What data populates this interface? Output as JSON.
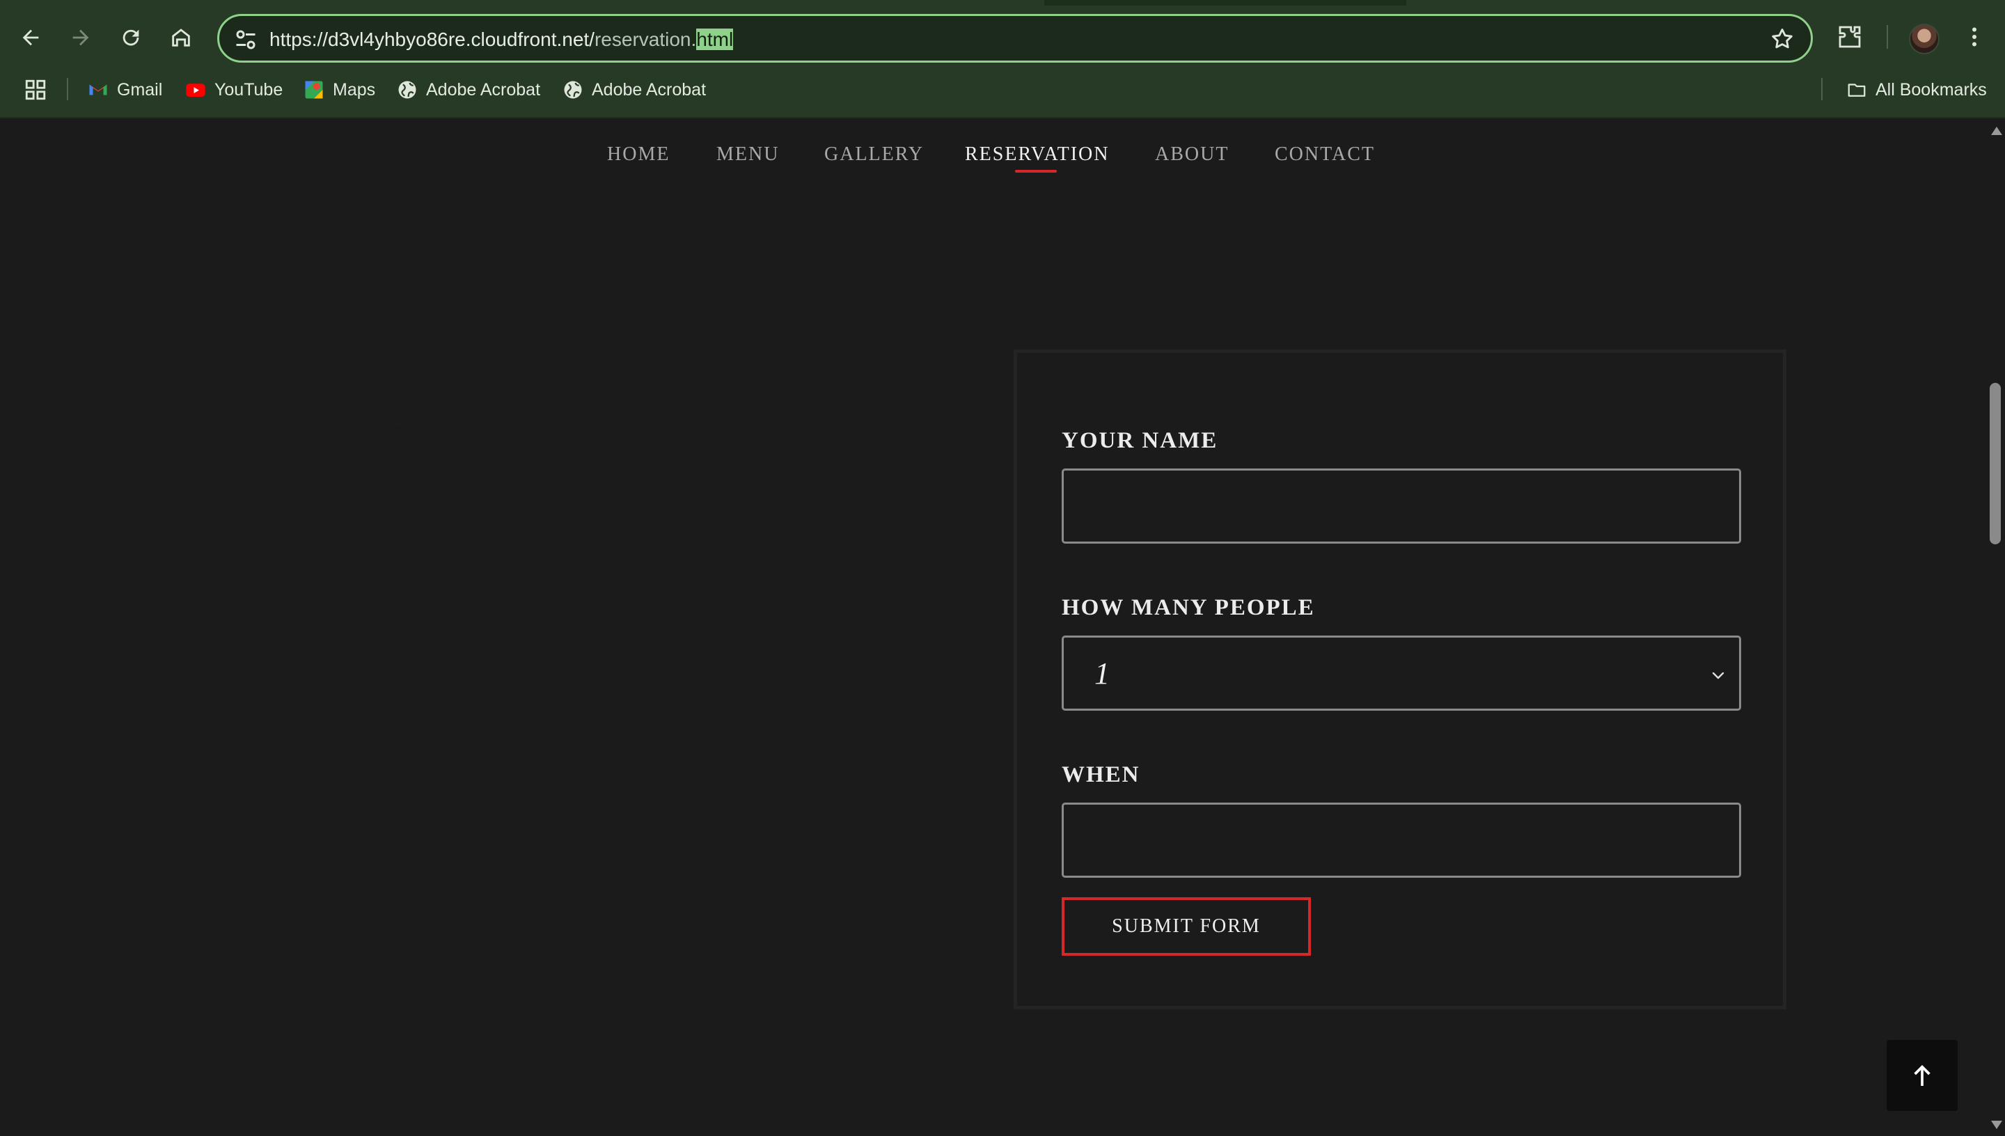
{
  "browser": {
    "url_host": "https://d3vl4yhbyo86re.cloudfront.net/",
    "url_path": "reservation.",
    "url_selected": "html",
    "bookmarks": [
      {
        "label": "Gmail",
        "icon": "gmail-icon"
      },
      {
        "label": "YouTube",
        "icon": "youtube-icon"
      },
      {
        "label": "Maps",
        "icon": "maps-icon"
      },
      {
        "label": "Adobe Acrobat",
        "icon": "globe-icon"
      },
      {
        "label": "Adobe Acrobat",
        "icon": "globe-icon"
      }
    ],
    "all_bookmarks_label": "All Bookmarks"
  },
  "site_nav": {
    "items": [
      "HOME",
      "MENU",
      "GALLERY",
      "RESERVATION",
      "ABOUT",
      "CONTACT"
    ],
    "active": "RESERVATION"
  },
  "form": {
    "name_label": "YOUR NAME",
    "name_value": "",
    "people_label": "HOW MANY PEOPLE",
    "people_value": "1",
    "when_label": "WHEN",
    "when_value": "",
    "submit_label": "SUBMIT FORM"
  },
  "colors": {
    "accent": "#d62828",
    "background": "#1b1b1b",
    "chrome": "#273a26",
    "omnibox_focus": "#8fd18a"
  }
}
